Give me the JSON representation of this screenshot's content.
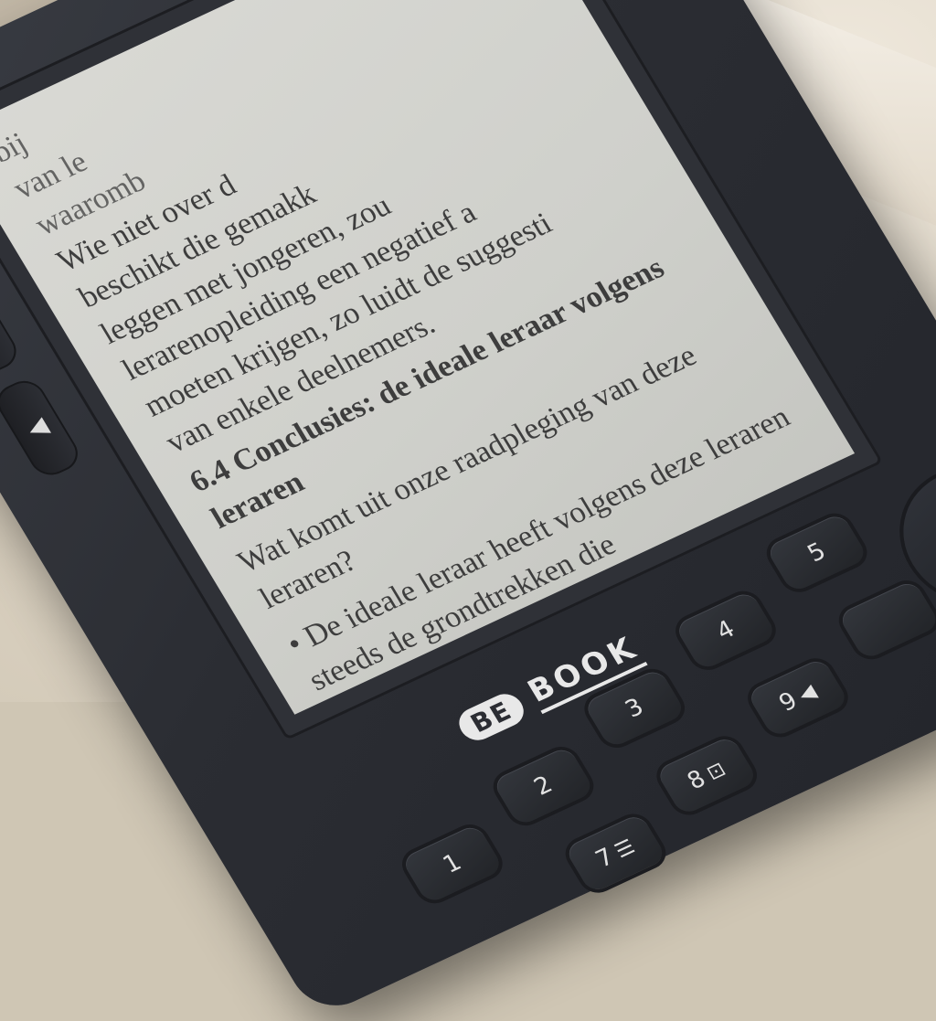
{
  "screen": {
    "lines_top": [
      "bij",
      "van le",
      "waaromb",
      "Wie niet over d",
      "beschikt die gemakk",
      "leggen met jongeren, zou",
      "lerarenopleiding een negatief a",
      "moeten krijgen, zo luidt de suggesti",
      "van enkele deelnemers."
    ],
    "heading": "6.4 Conclusies: de ideale leraar volgens leraren",
    "question": "Wat komt uit onze raadpleging van deze leraren?",
    "bullet": "• De ideale leraar heeft volgens deze leraren steeds de grondtrekken die"
  },
  "brand": {
    "badge": "BE",
    "word": "BOOK"
  },
  "side_buttons": [
    "▶",
    "◀"
  ],
  "keypad": {
    "k1": "1",
    "k2": "2",
    "k3": "3",
    "k4": "4",
    "k5": "5",
    "k7": "7",
    "k8": "8",
    "k9": "9"
  },
  "icons": {
    "back": "↶",
    "menu": "▤",
    "zoom": "⊡",
    "list": "☰",
    "arrow": "◀"
  }
}
